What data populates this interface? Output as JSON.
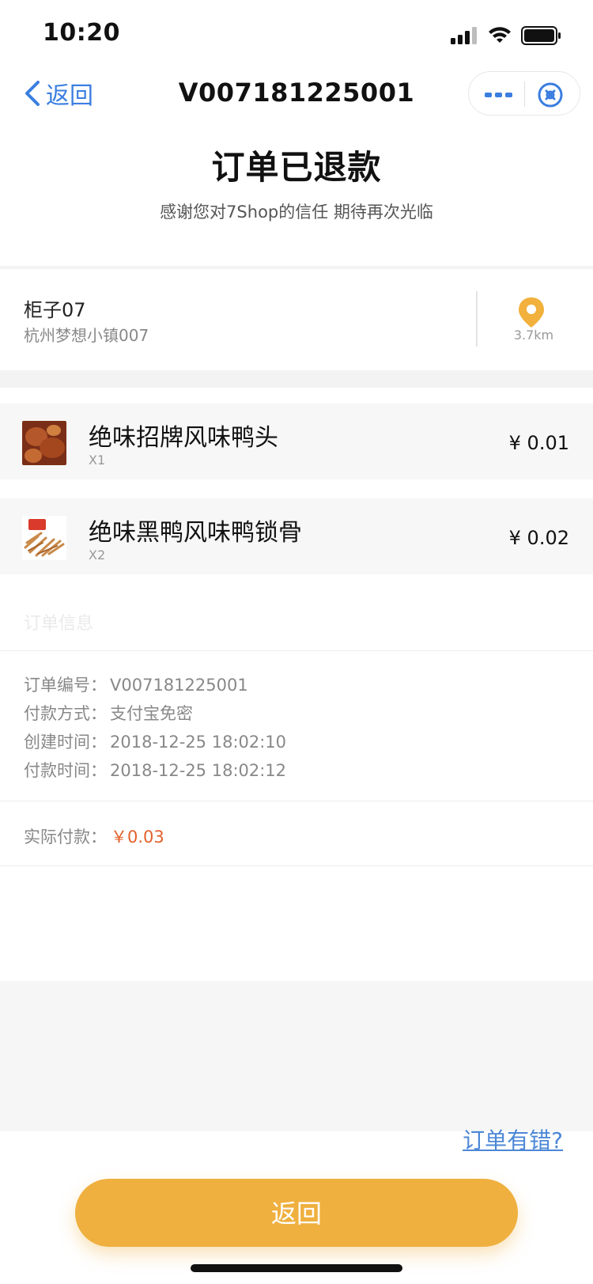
{
  "status_bar": {
    "time": "10:20"
  },
  "nav": {
    "back_label": "返回",
    "title": "V007181225001"
  },
  "header": {
    "headline": "订单已退款",
    "subline": "感谢您对7Shop的信任 期待再次光临"
  },
  "locker": {
    "name": "柜子07",
    "address": "杭州梦想小镇007",
    "distance": "3.7km",
    "pin_color": "#f2b13c"
  },
  "products": [
    {
      "name": "绝味招牌风味鸭头",
      "qty": "X1",
      "price": "¥ 0.01"
    },
    {
      "name": "绝味黑鸭风味鸭锁骨",
      "qty": "X2",
      "price": "¥ 0.02"
    }
  ],
  "order_info": {
    "section_title": "订单信息",
    "rows": [
      {
        "label": "订单编号：",
        "value": "V007181225001"
      },
      {
        "label": "付款方式：",
        "value": "支付宝免密"
      },
      {
        "label": "创建时间：",
        "value": "2018-12-25 18:02:10"
      },
      {
        "label": "付款时间：",
        "value": "2018-12-25 18:02:12"
      }
    ],
    "paid_label": "实际付款：",
    "paid_value": "￥0.03"
  },
  "footer": {
    "error_link": "订单有错?",
    "back_button": "返回"
  },
  "colors": {
    "accent_blue": "#3b7ee0",
    "button_orange": "#efb03f",
    "price_red": "#e2612b"
  }
}
